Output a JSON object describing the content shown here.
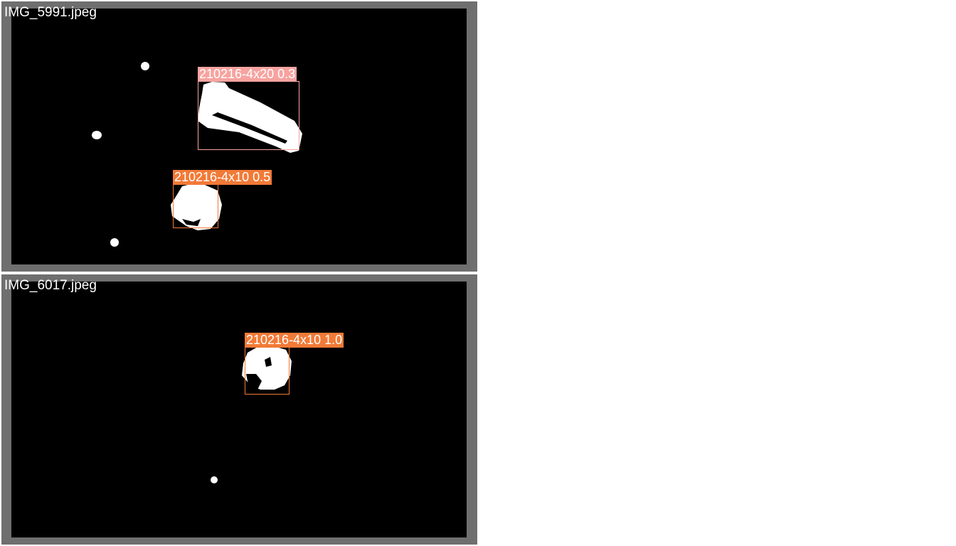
{
  "panels": [
    {
      "filename": "IMG_5991.jpeg",
      "detections": [
        {
          "label": "210216-4x20 0.3",
          "color": "#f7a3a0"
        },
        {
          "label": "210216-4x10 0.5",
          "color": "#f27a37"
        }
      ]
    },
    {
      "filename": "IMG_6017.jpeg",
      "detections": [
        {
          "label": "210216-4x10 1.0",
          "color": "#f27a37"
        }
      ]
    }
  ]
}
